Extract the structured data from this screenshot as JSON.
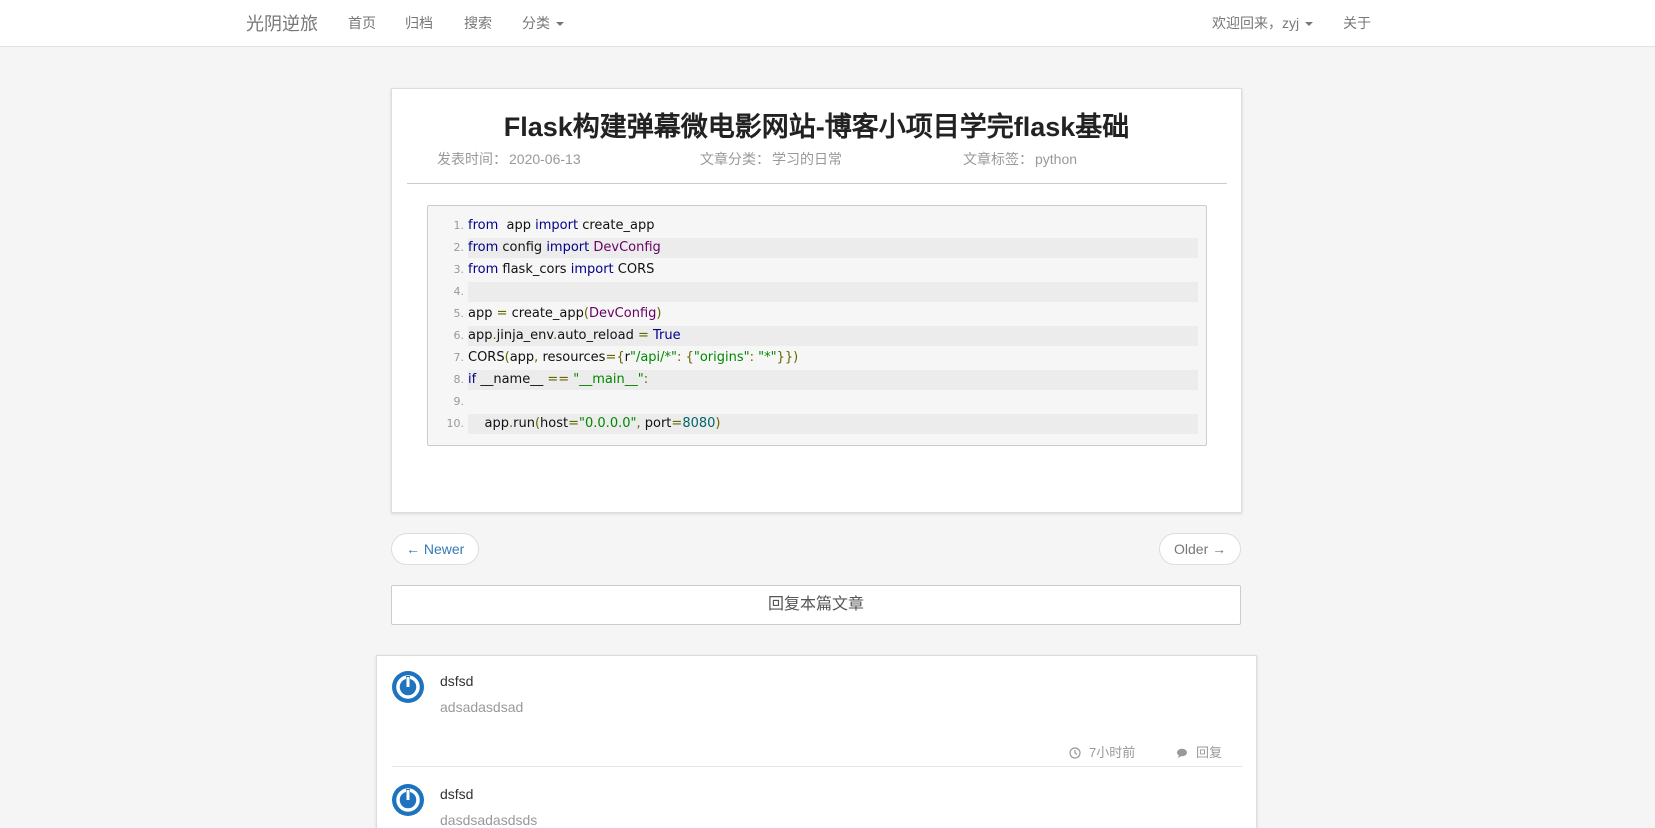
{
  "navbar": {
    "brand": "光阴逆旅",
    "links": [
      "首页",
      "归档",
      "搜索"
    ],
    "category_label": "分类",
    "welcome": "欢迎回来，zyj",
    "about": "关于"
  },
  "article": {
    "title": "Flask构建弹幕微电影网站-博客小项目学完flask基础",
    "date_label": "发表时间：",
    "date": "2020-06-13",
    "category_label": "文章分类：",
    "category": "学习的日常",
    "tags_label": "文章标签：",
    "tags": "python"
  },
  "code_lines": [
    {
      "num": "1.",
      "parts": [
        [
          "kw",
          "from"
        ],
        [
          "",
          "  app "
        ],
        [
          "kw",
          "import"
        ],
        [
          "",
          " create_app"
        ]
      ]
    },
    {
      "num": "2.",
      "parts": [
        [
          "kw",
          "from"
        ],
        [
          "",
          " config "
        ],
        [
          "kw",
          "import"
        ],
        [
          "",
          " "
        ],
        [
          "cls",
          "DevConfig"
        ]
      ]
    },
    {
      "num": "3.",
      "parts": [
        [
          "kw",
          "from"
        ],
        [
          "",
          " flask_cors "
        ],
        [
          "kw",
          "import"
        ],
        [
          "",
          " CORS"
        ]
      ]
    },
    {
      "num": "4.",
      "parts": []
    },
    {
      "num": "5.",
      "parts": [
        [
          "",
          "app "
        ],
        [
          "pun",
          "="
        ],
        [
          "",
          " create_app"
        ],
        [
          "pun",
          "("
        ],
        [
          "cls",
          "DevConfig"
        ],
        [
          "pun",
          ")"
        ]
      ]
    },
    {
      "num": "6.",
      "parts": [
        [
          "",
          "app"
        ],
        [
          "pun",
          "."
        ],
        [
          "",
          "jinja_env"
        ],
        [
          "pun",
          "."
        ],
        [
          "",
          "auto_reload "
        ],
        [
          "pun",
          "="
        ],
        [
          "",
          " "
        ],
        [
          "kw",
          "True"
        ]
      ]
    },
    {
      "num": "7.",
      "parts": [
        [
          "",
          "CORS"
        ],
        [
          "pun",
          "("
        ],
        [
          "",
          "app"
        ],
        [
          "pun",
          ","
        ],
        [
          "",
          " resources"
        ],
        [
          "pun",
          "={"
        ],
        [
          "",
          "r"
        ],
        [
          "str",
          "\"/api/*\""
        ],
        [
          "pun",
          ":"
        ],
        [
          "",
          " "
        ],
        [
          "pun",
          "{"
        ],
        [
          "str",
          "\"origins\""
        ],
        [
          "pun",
          ":"
        ],
        [
          "",
          " "
        ],
        [
          "str",
          "\"*\""
        ],
        [
          "pun",
          "}})"
        ]
      ]
    },
    {
      "num": "8.",
      "parts": [
        [
          "kw",
          "if"
        ],
        [
          "",
          " __name__ "
        ],
        [
          "pun",
          "=="
        ],
        [
          "",
          " "
        ],
        [
          "str",
          "\"__main__\""
        ],
        [
          "pun",
          ":"
        ]
      ]
    },
    {
      "num": "9.",
      "parts": []
    },
    {
      "num": "10.",
      "parts": [
        [
          "",
          "    app"
        ],
        [
          "pun",
          "."
        ],
        [
          "",
          "run"
        ],
        [
          "pun",
          "("
        ],
        [
          "",
          "host"
        ],
        [
          "pun",
          "="
        ],
        [
          "str",
          "\"0.0.0.0\""
        ],
        [
          "pun",
          ","
        ],
        [
          "",
          " port"
        ],
        [
          "pun",
          "="
        ],
        [
          "num",
          "8080"
        ],
        [
          "pun",
          ")"
        ]
      ]
    }
  ],
  "pager": {
    "newer": "← Newer",
    "older": "Older →"
  },
  "reply_article": "回复本篇文章",
  "comments": [
    {
      "author": "dsfsd",
      "body": "adsadasdsad",
      "time": "7小时前",
      "reply": "回复"
    },
    {
      "author": "dsfsd",
      "body": "dasdsadasdsds"
    }
  ],
  "colors": {
    "accent": "#337ab7",
    "avatar": "#1e73be",
    "keyword": "#000088",
    "string": "#008800"
  }
}
